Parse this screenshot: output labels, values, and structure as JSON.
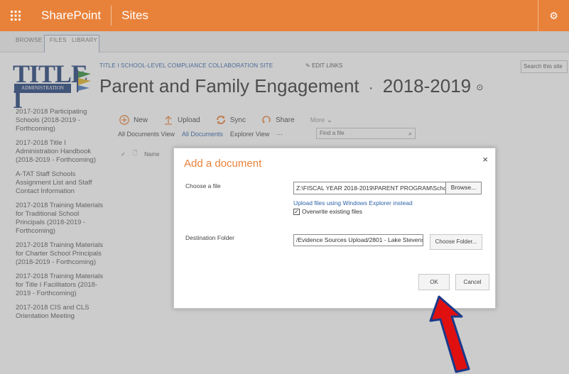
{
  "suite_bar": {
    "brand": "SharePoint",
    "sites": "Sites"
  },
  "ribbon": {
    "tabs": [
      "BROWSE",
      "FILES",
      "LIBRARY"
    ]
  },
  "logo": {
    "title": "TITLE I",
    "subtitle": "ADMINISTRATION"
  },
  "header": {
    "site_title": "TITLE I SCHOOL-LEVEL COMPLIANCE COLLABORATION SITE",
    "edit_links": "EDIT LINKS",
    "page_title": "Parent and Family Engagement",
    "separator": "·",
    "year": "2018-2019",
    "search_placeholder": "Search this site"
  },
  "left_nav": {
    "items": [
      "2017-2018 Participating Schools (2018-2019 - Forthcoming)",
      "2017-2018 Title I Administration Handbook (2018-2019 - Forthcoming)",
      "A-TAT Staff Schools Assignment List and Staff Contact Information",
      "2017-2018 Training Materials for Traditional School Principals (2018-2019 - Forthcoming)",
      "2017-2018 Training Materials for Charter School Principals (2018-2019 - Forthcoming)",
      "2017-2018 Training Materials for Title I Facilitators (2018-2019 - Forthcoming)",
      "2017-2018 CIS and CLS Orientation Meeting"
    ]
  },
  "toolbar": {
    "new": "New",
    "upload": "Upload",
    "sync": "Sync",
    "share": "Share",
    "more": "More"
  },
  "views": {
    "all_documents_view": "All Documents View",
    "all_documents": "All Documents",
    "explorer_view": "Explorer View",
    "ellipsis": "···",
    "find_placeholder": "Find a file"
  },
  "list": {
    "name_header": "Name"
  },
  "dialog": {
    "title": "Add a document",
    "close": "×",
    "choose_file_label": "Choose a file",
    "file_path": "Z:\\FISCAL YEAR 2018-2019\\PARENT PROGRAM\\Schoo",
    "browse": "Browse...",
    "upload_link": "Upload files using Windows Explorer instead",
    "overwrite": "Overwrite existing files",
    "overwrite_checked": true,
    "destination_label": "Destination Folder",
    "destination_value": "/Evidence Sources Upload/2801 - Lake Stevens",
    "choose_folder": "Choose Folder...",
    "ok": "OK",
    "cancel": "Cancel"
  },
  "colors": {
    "accent": "#e8823a",
    "link": "#2e62a8",
    "arrow_fill": "#e01010",
    "arrow_stroke": "#1a3a8a"
  }
}
